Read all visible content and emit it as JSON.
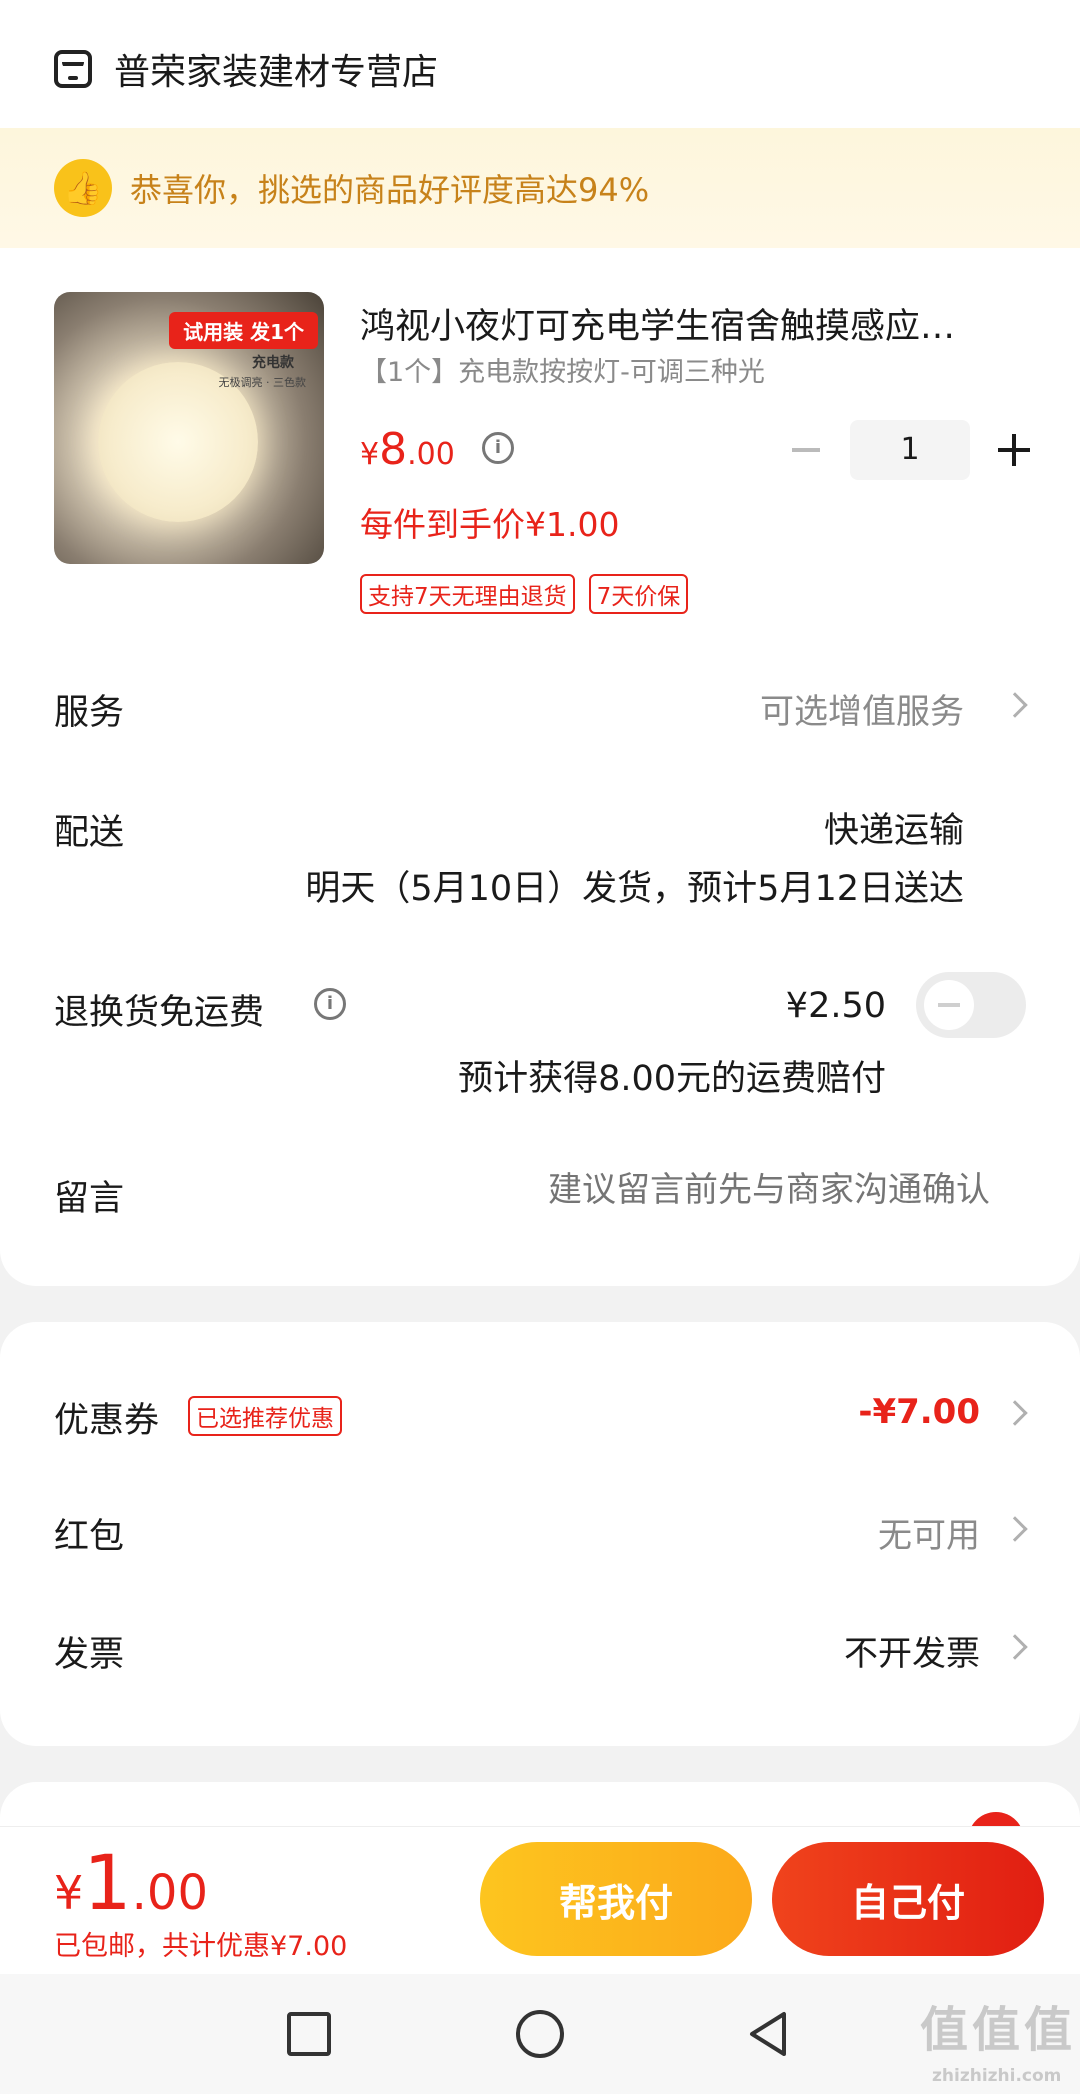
{
  "store": {
    "name": "普荣家装建材专营店"
  },
  "banner": {
    "text": "恭喜你，挑选的商品好评度高达94%"
  },
  "product": {
    "image_tag": "试用装 发1个",
    "image_sub1": "充电款",
    "image_sub2": "无极调亮 · 三色款",
    "title": "鸿视小夜灯可充电学生宿舍触摸感应…",
    "spec": "【1个】充电款按按灯-可调三种光",
    "price_symbol": "¥",
    "price_int": "8",
    "price_dec": ".00",
    "quantity": "1",
    "final_price": "每件到手价¥1.00",
    "badges": [
      "支持7天无理由退货",
      "7天价保"
    ]
  },
  "service": {
    "label": "服务",
    "value": "可选增值服务"
  },
  "delivery": {
    "label": "配送",
    "method": "快递运输",
    "date": "明天（5月10日）发货，预计5月12日送达"
  },
  "return_shipping": {
    "label": "退换货免运费",
    "price": "¥2.50",
    "compensation": "预计获得8.00元的运费赔付",
    "enabled": false
  },
  "message": {
    "label": "留言",
    "placeholder": "建议留言前先与商家沟通确认"
  },
  "coupon": {
    "label": "优惠券",
    "tag": "已选推荐优惠",
    "value": "-¥7.00"
  },
  "red_packet": {
    "label": "红包",
    "value": "无可用"
  },
  "invoice": {
    "label": "发票",
    "value": "不开发票"
  },
  "footer": {
    "total_symbol": "¥",
    "total_int": "1",
    "total_dec": ".00",
    "total_sub": "已包邮，共计优惠¥7.00",
    "help_pay": "帮我付",
    "self_pay": "自己付"
  },
  "watermark": {
    "text": "值值值",
    "url": "zhizhizhi.com"
  },
  "colors": {
    "accent": "#e8231a",
    "banner_text": "#c7821a",
    "help_btn": "#fdc51f"
  }
}
